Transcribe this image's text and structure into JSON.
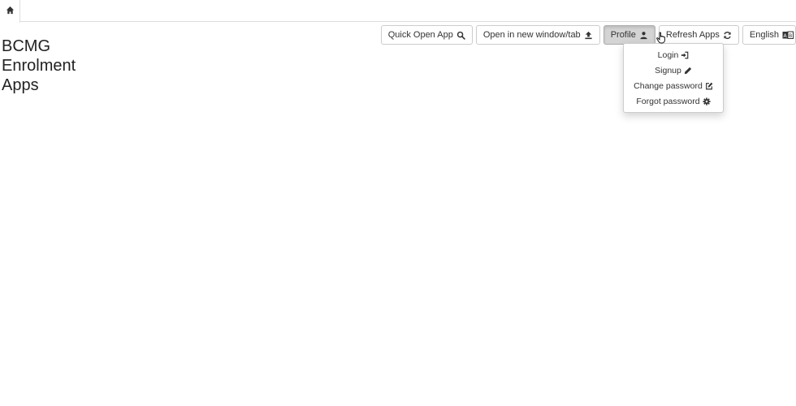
{
  "tabs": {
    "home_icon": "home-icon"
  },
  "header": {
    "title_lines": [
      "BCMG",
      "Enrolment",
      "Apps"
    ]
  },
  "toolbar": {
    "quick_open_label": "Quick Open App",
    "quick_open_icon": "search-icon",
    "open_new_label": "Open in new window/tab",
    "open_new_icon": "upload-icon",
    "profile_label": "Profile",
    "profile_icon": "user-icon",
    "refresh_label": "Refresh Apps",
    "refresh_icon": "refresh-icon",
    "language_label": "English",
    "language_icon": "language-icon"
  },
  "profile_menu": {
    "items": [
      {
        "label": "Login",
        "icon": "login-icon"
      },
      {
        "label": "Signup",
        "icon": "pencil-icon"
      },
      {
        "label": "Change password",
        "icon": "edit-icon"
      },
      {
        "label": "Forgot password",
        "icon": "gear-icon"
      }
    ]
  },
  "colors": {
    "active_button": "#d4d4d4",
    "border": "#cccccc",
    "text": "#333333"
  }
}
